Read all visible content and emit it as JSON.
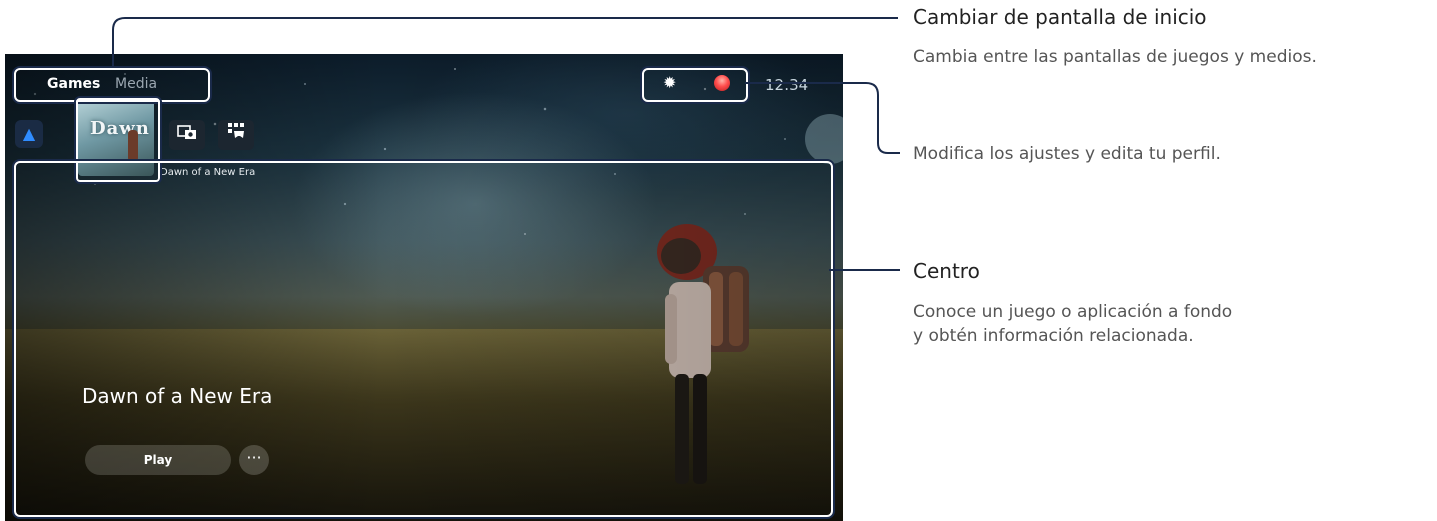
{
  "screen": {
    "tabs": {
      "games": "Games",
      "media": "Media"
    },
    "clock": "12:34",
    "game_tile_logo": "Dawn",
    "game_caption": "Dawn of a New Era",
    "hero_title": "Dawn of a New Era",
    "play_label": "Play",
    "more_label": "···",
    "icons": {
      "store": "playstation-store-icon",
      "gallery": "media-gallery-icon",
      "controller": "game-library-icon",
      "settings": "settings-gear-icon",
      "avatar": "profile-avatar-icon"
    }
  },
  "callouts": {
    "home_switch": {
      "title": "Cambiar de pantalla de inicio",
      "desc": "Cambia entre las pantallas de juegos y medios."
    },
    "settings_profile": {
      "desc": "Modifica los ajustes y edita tu perfil."
    },
    "hub": {
      "title": "Centro",
      "desc_line1": "Conoce un juego o aplicación a fondo",
      "desc_line2": "y obtén información relacionada."
    }
  },
  "colors": {
    "callout_line": "#1a2a4a",
    "outline": "#ffffff"
  }
}
